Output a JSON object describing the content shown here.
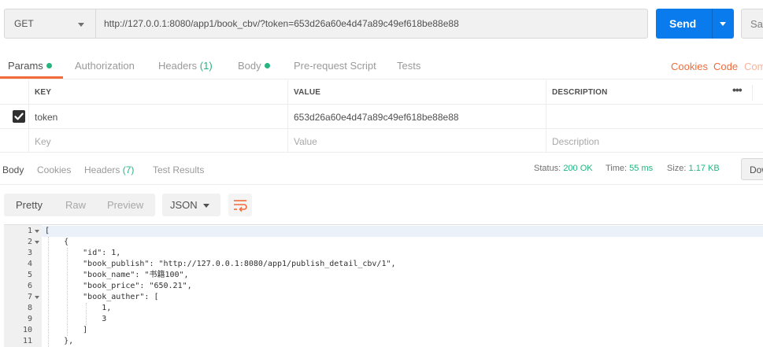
{
  "request": {
    "method": "GET",
    "url": "http://127.0.0.1:8080/app1/book_cbv/?token=653d26a60e4d47a89c49ef618be88e88",
    "send_label": "Send",
    "save_label": "Sav"
  },
  "request_tabs": {
    "params": "Params",
    "authorization": "Authorization",
    "headers": "Headers",
    "headers_count": "(1)",
    "body": "Body",
    "prerequest": "Pre-request Script",
    "tests": "Tests",
    "cookies_link": "Cookies",
    "code_link": "Code",
    "comments_link": "Com"
  },
  "params_table": {
    "headers": {
      "key": "KEY",
      "value": "VALUE",
      "description": "DESCRIPTION",
      "more": "•••"
    },
    "rows": [
      {
        "key": "token",
        "value": "653d26a60e4d47a89c49ef618be88e88",
        "checked": true
      }
    ],
    "placeholders": {
      "key": "Key",
      "value": "Value",
      "description": "Description"
    }
  },
  "response": {
    "tabs": {
      "body": "Body",
      "cookies": "Cookies",
      "headers": "Headers",
      "headers_count": "(7)",
      "tests": "Test Results"
    },
    "status_label": "Status:",
    "status_value": "200 OK",
    "time_label": "Time:",
    "time_value": "55 ms",
    "size_label": "Size:",
    "size_value": "1.17 KB",
    "download_label": "Dow"
  },
  "viewer": {
    "pretty": "Pretty",
    "raw": "Raw",
    "preview": "Preview",
    "format": "JSON"
  },
  "code": {
    "line_numbers": [
      "1",
      "2",
      "3",
      "4",
      "5",
      "6",
      "7",
      "8",
      "9",
      "10",
      "11"
    ],
    "lines": [
      "[",
      "    {",
      "        \"id\": 1,",
      "        \"book_publish\": \"http://127.0.0.1:8080/app1/publish_detail_cbv/1\",",
      "        \"book_name\": \"书籍100\",",
      "        \"book_price\": \"650.21\",",
      "        \"book_auther\": [",
      "            1,",
      "            3",
      "        ]",
      "    },"
    ]
  },
  "colors": {
    "accent": "#f26b3a",
    "send": "#097bed",
    "success": "#26b47f",
    "json_key": "#2f6fb3"
  }
}
